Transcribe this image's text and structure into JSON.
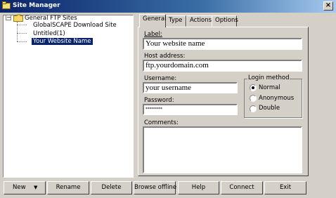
{
  "window": {
    "title": "Site Manager",
    "close_glyph": "×"
  },
  "tree": {
    "root": {
      "label": "General FTP Sites",
      "expander": "−",
      "icon": "folder-icon"
    },
    "children": [
      {
        "label": "GlobalSCAPE Download Site"
      },
      {
        "label": "Untitled(1)"
      },
      {
        "label": "Your Website Name",
        "selected": true
      }
    ]
  },
  "tabs": [
    {
      "label": "General",
      "active": true
    },
    {
      "label": "Type"
    },
    {
      "label": "Actions"
    },
    {
      "label": "Options"
    }
  ],
  "general": {
    "label_label": "Label:",
    "label_value": "Your website name",
    "host_label": "Host address:",
    "host_value": "ftp.yourdomain.com",
    "username_label": "Username:",
    "username_value": "your username",
    "password_label": "Password:",
    "password_value": "********",
    "comments_label": "Comments:",
    "comments_value": ""
  },
  "login_method": {
    "title": "Login method",
    "options": [
      {
        "label": "Normal",
        "selected": true
      },
      {
        "label": "Anonymous",
        "selected": false
      },
      {
        "label": "Double",
        "selected": false
      }
    ]
  },
  "buttons": {
    "new": "New",
    "new_arrow": "▼",
    "rename": "Rename",
    "delete": "Delete",
    "browse_offline": "Browse offline",
    "help": "Help",
    "connect": "Connect",
    "exit": "Exit"
  },
  "colors": {
    "titlebar": "#0a246a",
    "selection": "#0a246a",
    "face": "#d4d0c8"
  }
}
